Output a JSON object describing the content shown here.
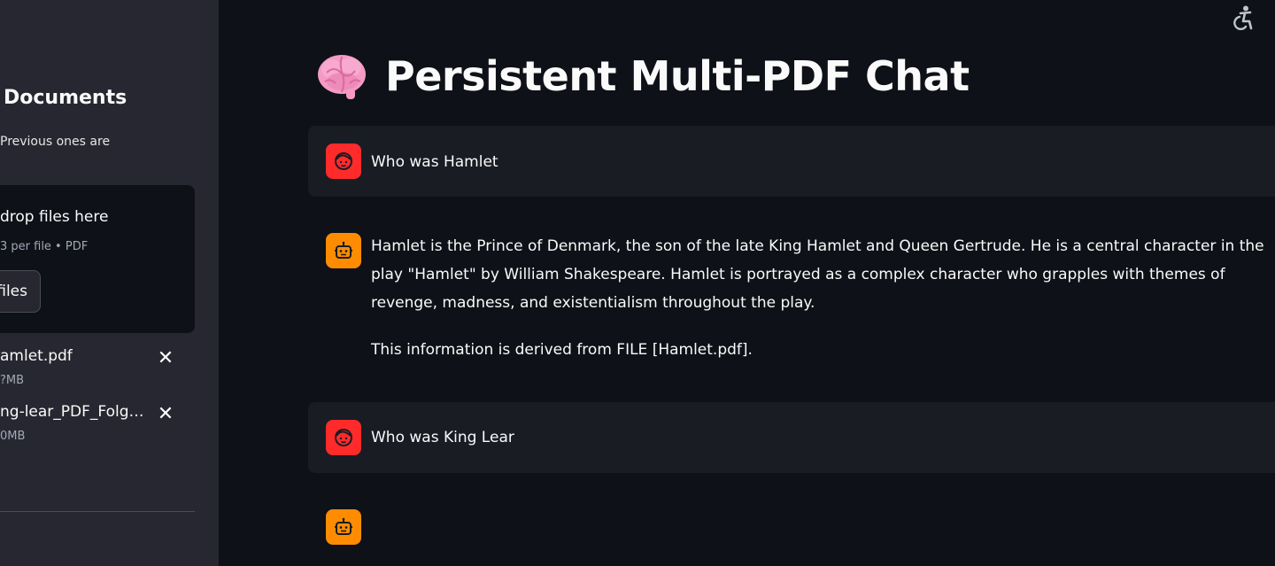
{
  "sidebar": {
    "title": "Documents",
    "subtitle": "Previous ones are",
    "uploader": {
      "dropzone_text": "drop files here",
      "limit_text": "3 per file • PDF",
      "browse_label": "files"
    },
    "files": [
      {
        "name": "amlet.pdf",
        "size": "?MB",
        "icon": "close-icon"
      },
      {
        "name": "ng-lear_PDF_FolgerShakespeare.pdf",
        "size": "0MB",
        "icon": "close-icon"
      }
    ]
  },
  "header": {
    "title": "Persistent Multi-PDF Chat",
    "icon": "brain-icon",
    "a11y_icon": "accessibility-icon"
  },
  "chat": {
    "messages": [
      {
        "role": "user",
        "avatar": "user-face-icon",
        "text": "Who was Hamlet"
      },
      {
        "role": "assistant",
        "avatar": "robot-icon",
        "paragraphs": [
          "Hamlet is the Prince of Denmark, the son of the late King Hamlet and Queen Gertrude. He is a central character in the play \"Hamlet\" by William Shakespeare. Hamlet is portrayed as a complex character who grapples with themes of revenge, madness, and existentialism throughout the play.",
          "This information is derived from FILE [Hamlet.pdf]."
        ]
      },
      {
        "role": "user",
        "avatar": "user-face-icon",
        "text": "Who was King Lear"
      },
      {
        "role": "assistant",
        "avatar": "robot-icon",
        "paragraphs": []
      }
    ]
  },
  "colors": {
    "background": "#0e1117",
    "sidebar": "#262730",
    "user_avatar": "#ff2b2b",
    "bot_avatar": "#ff8c00"
  }
}
